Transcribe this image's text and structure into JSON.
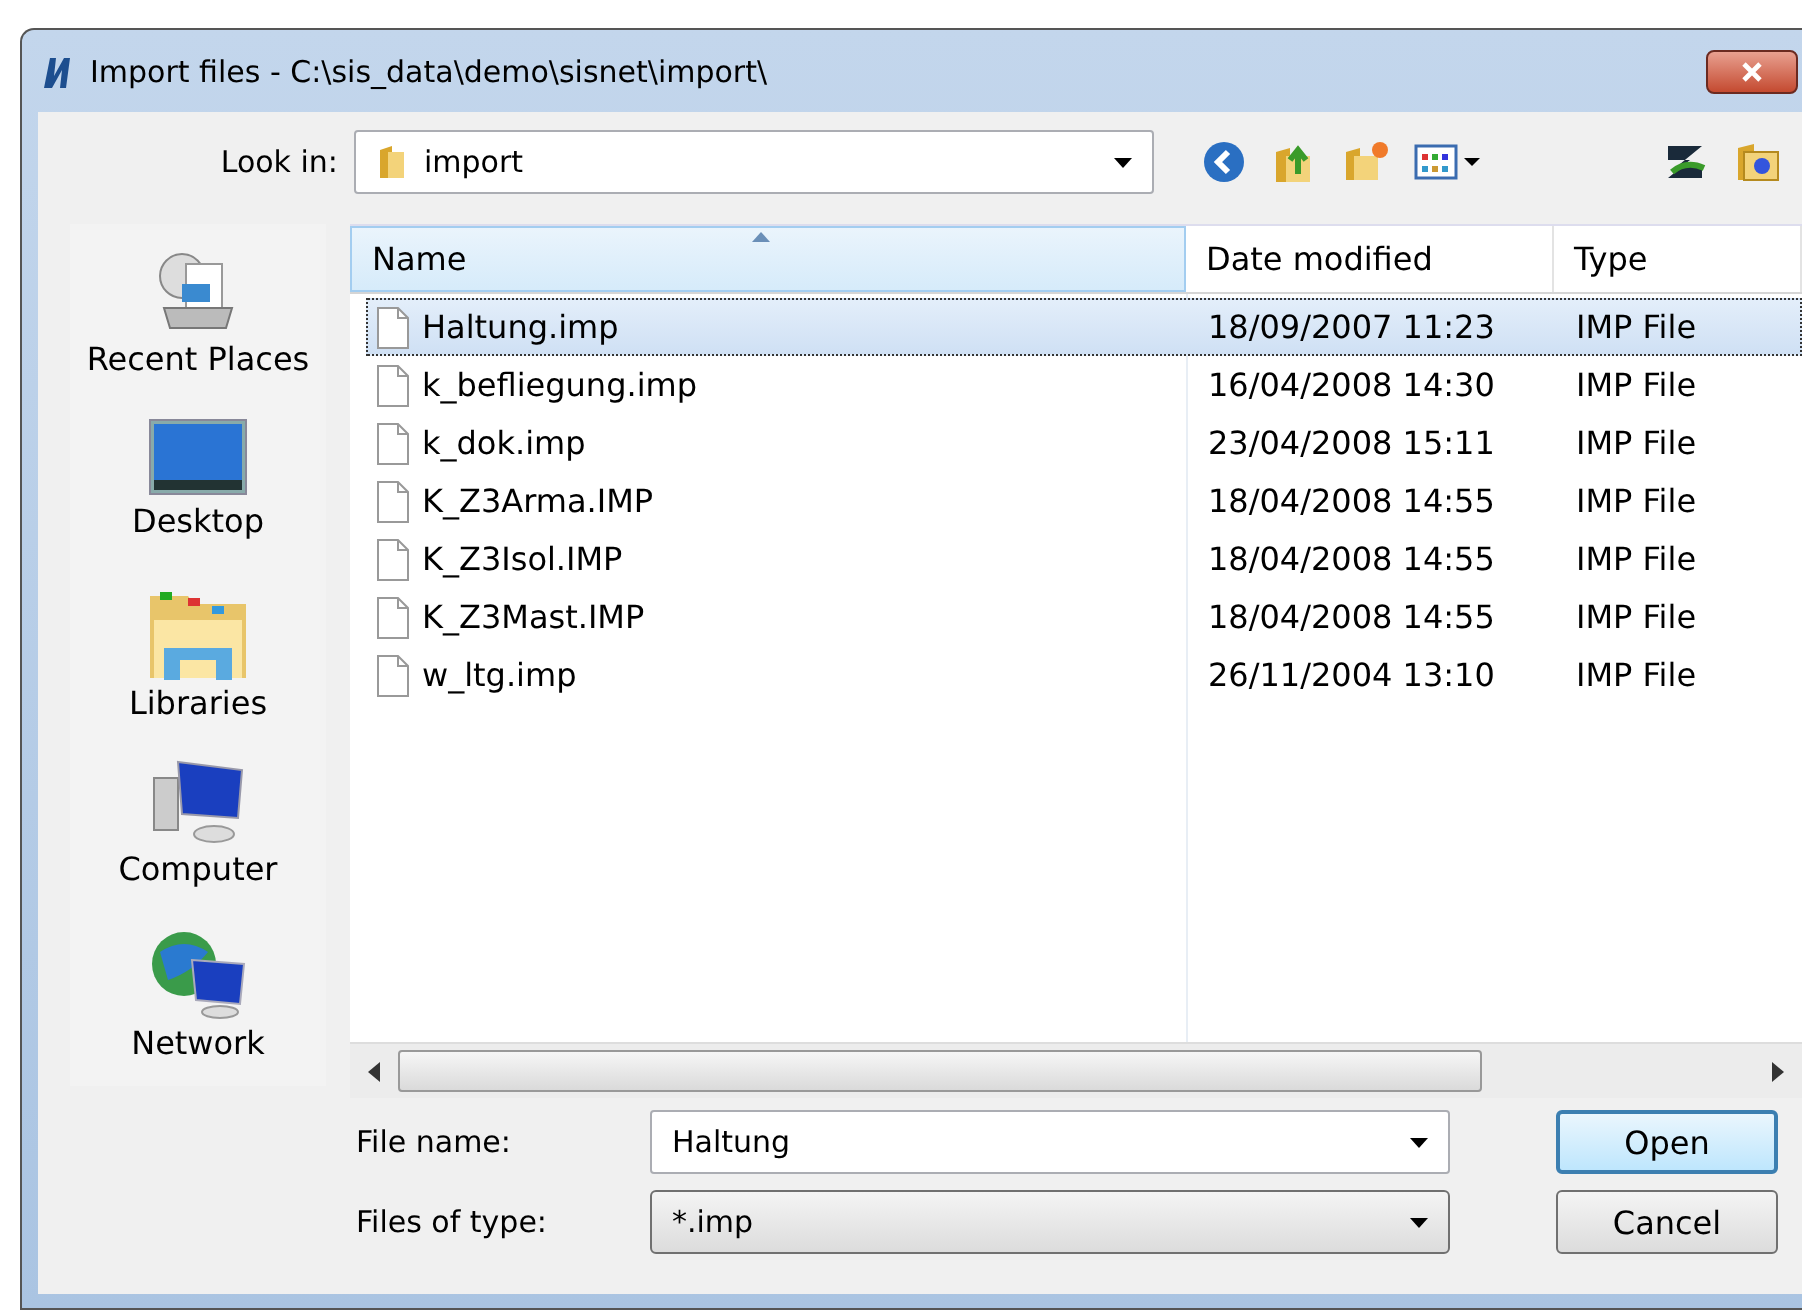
{
  "window": {
    "title": "Import files - C:\\sis_data\\demo\\sisnet\\import\\"
  },
  "look_in": {
    "label": "Look in:",
    "value": "import"
  },
  "sidebar": {
    "items": [
      {
        "label": "Recent Places",
        "kind": "recent"
      },
      {
        "label": "Desktop",
        "kind": "desktop"
      },
      {
        "label": "Libraries",
        "kind": "libraries"
      },
      {
        "label": "Computer",
        "kind": "computer"
      },
      {
        "label": "Network",
        "kind": "network"
      }
    ]
  },
  "table": {
    "columns": [
      {
        "label": "Name",
        "sorted": true
      },
      {
        "label": "Date modified",
        "sorted": false
      },
      {
        "label": "Type",
        "sorted": false
      }
    ],
    "rows": [
      {
        "name": "Haltung.imp",
        "date": "18/09/2007 11:23",
        "type": "IMP File",
        "selected": true
      },
      {
        "name": "k_befliegung.imp",
        "date": "16/04/2008 14:30",
        "type": "IMP File",
        "selected": false
      },
      {
        "name": "k_dok.imp",
        "date": "23/04/2008 15:11",
        "type": "IMP File",
        "selected": false
      },
      {
        "name": "K_Z3Arma.IMP",
        "date": "18/04/2008 14:55",
        "type": "IMP File",
        "selected": false
      },
      {
        "name": "K_Z3Isol.IMP",
        "date": "18/04/2008 14:55",
        "type": "IMP File",
        "selected": false
      },
      {
        "name": "K_Z3Mast.IMP",
        "date": "18/04/2008 14:55",
        "type": "IMP File",
        "selected": false
      },
      {
        "name": "w_ltg.imp",
        "date": "26/11/2004 13:10",
        "type": "IMP File",
        "selected": false
      }
    ]
  },
  "file_name": {
    "label": "File name:",
    "value": "Haltung"
  },
  "file_type": {
    "label": "Files of type:",
    "value": "*.imp"
  },
  "buttons": [
    {
      "label": "Open",
      "default": true
    },
    {
      "label": "Cancel",
      "default": false
    }
  ]
}
